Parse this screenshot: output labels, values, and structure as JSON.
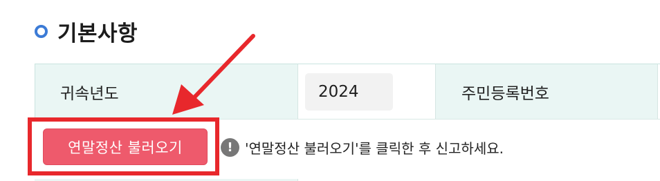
{
  "section": {
    "title": "기본사항",
    "bullet_icon": "circle-bullet-icon",
    "accent": "#3c7bd6"
  },
  "table": {
    "row1": {
      "tax_year_label": "귀속년도",
      "tax_year_value": "2024",
      "resident_number_label": "주민등록번호"
    }
  },
  "load_button": {
    "label": "연말정산 불러오기",
    "color": "#ee5a6c"
  },
  "notice": {
    "icon": "exclamation-circle-icon",
    "text": "'연말정산 불러오기'를 클릭한 후 신고하세요."
  },
  "annotation": {
    "highlight_color": "#e8282c",
    "arrow_icon": "red-arrow-icon"
  }
}
